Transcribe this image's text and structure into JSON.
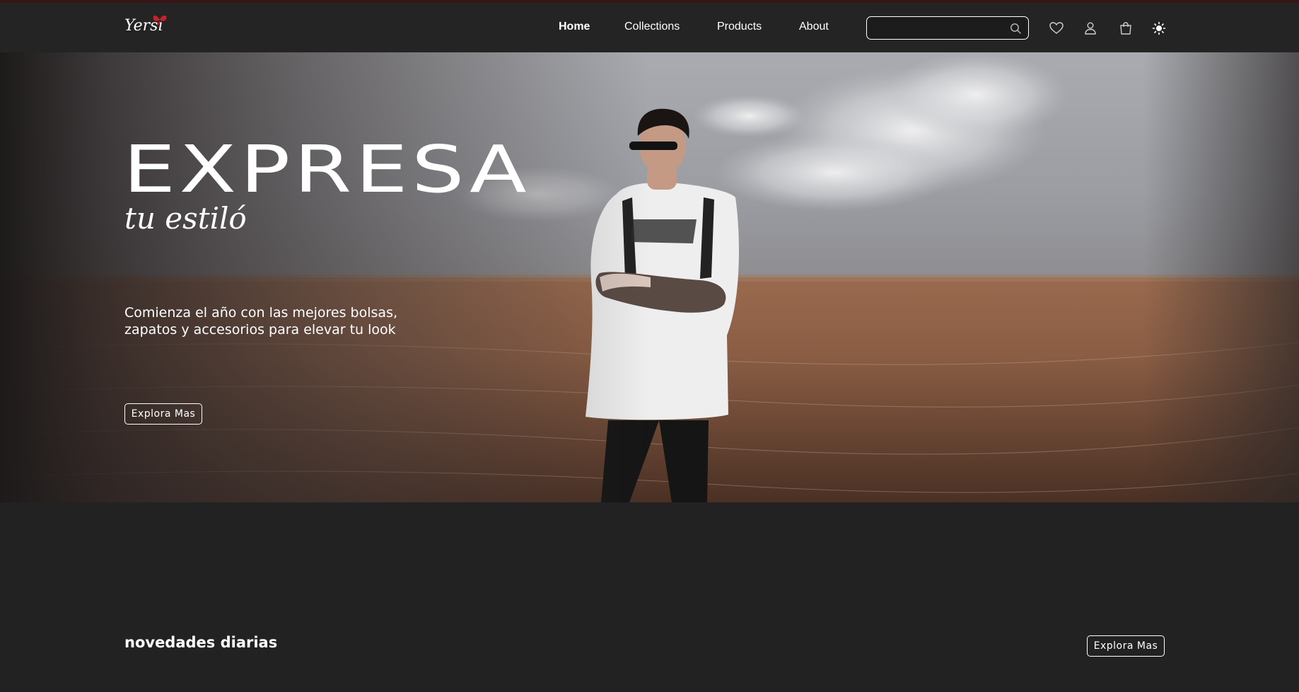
{
  "brand": {
    "logo_text": "Yersi",
    "accent": "#c8202a"
  },
  "nav": {
    "links": [
      {
        "label": "Home",
        "active": true
      },
      {
        "label": "Collections",
        "active": false
      },
      {
        "label": "Products",
        "active": false
      },
      {
        "label": "About",
        "active": false
      }
    ],
    "search": {
      "value": "",
      "placeholder": "",
      "icon": "search-icon"
    },
    "icons": [
      "heart-icon",
      "user-icon",
      "cart-icon",
      "sun-icon"
    ]
  },
  "hero": {
    "title": "EXPRESA",
    "script": "tu estiló",
    "description": "Comienza el año con las mejores bolsas, zapatos y accesorios para elevar tu look",
    "button_label": "Explora Mas"
  },
  "section": {
    "title": "novedades diarias",
    "button_label": "Explora Mas"
  }
}
